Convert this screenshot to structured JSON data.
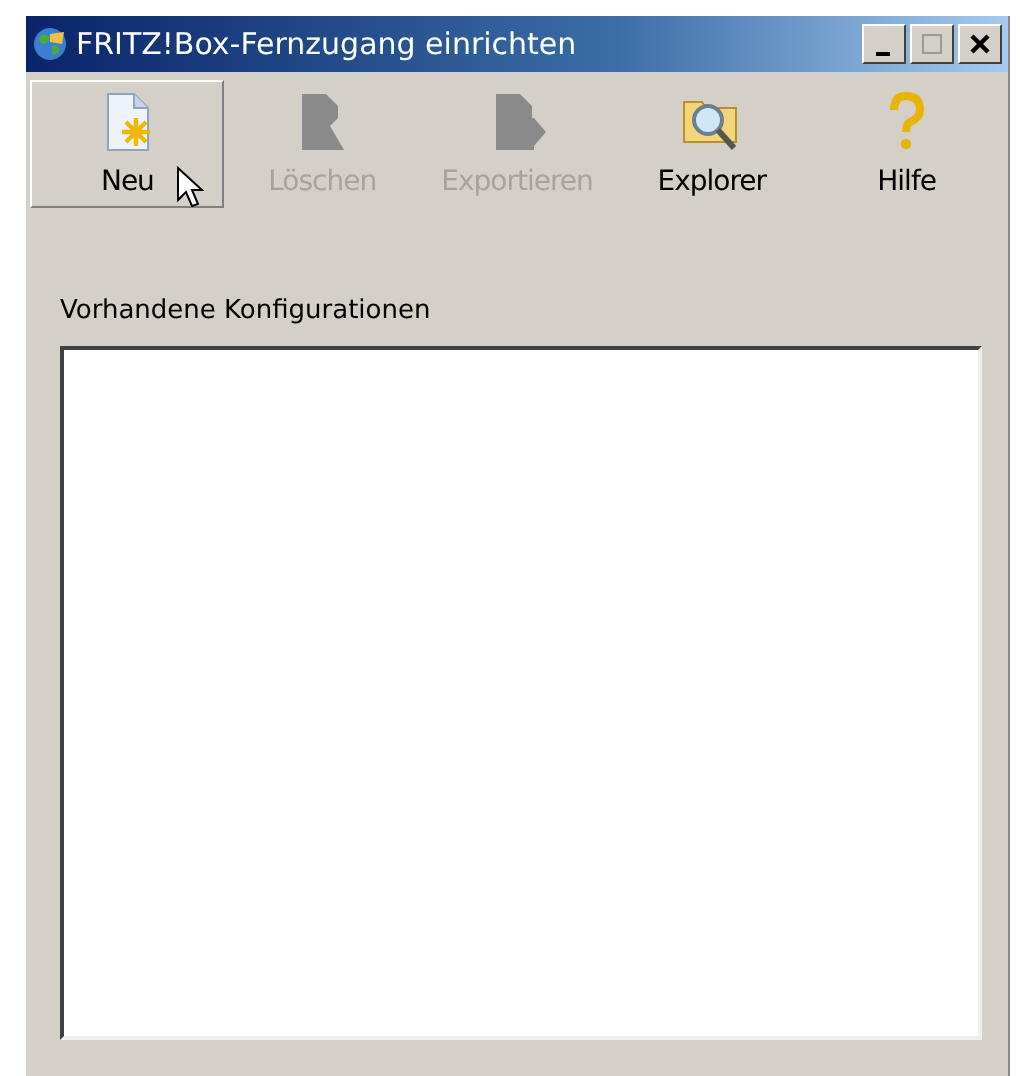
{
  "window": {
    "title": "FRITZ!Box-Fernzugang einrichten"
  },
  "toolbar": {
    "buttons": [
      {
        "kind": "new",
        "label": "Neu",
        "disabled": false,
        "hovered": true
      },
      {
        "kind": "delete",
        "label": "Löschen",
        "disabled": true,
        "hovered": false
      },
      {
        "kind": "export",
        "label": "Exportieren",
        "disabled": true,
        "hovered": false
      },
      {
        "kind": "explorer",
        "label": "Explorer",
        "disabled": false,
        "hovered": false
      },
      {
        "kind": "help",
        "label": "Hilfe",
        "disabled": false,
        "hovered": false
      }
    ]
  },
  "configurations": {
    "label": "Vorhandene Konfigurationen"
  }
}
